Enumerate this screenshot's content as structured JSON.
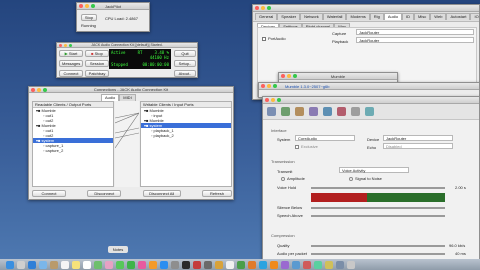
{
  "small_window": {
    "title": "JackPilot",
    "stop": "Stop",
    "running": "Running",
    "cpu_load": "CPU Load: 2.4867"
  },
  "control": {
    "title": "JACK Audio Connection Kit [(default)] Started.",
    "buttons": [
      "Start",
      "Stop",
      "Messages",
      "Session",
      "Connect",
      "Patchbay"
    ],
    "status": {
      "active": "Active",
      "rt": "RT",
      "load": "3.48 %",
      "rate": "44100 Hz",
      "stopped": "Stopped",
      "time": "00:00:00:00"
    },
    "side_buttons": [
      "Quit",
      "Setup..",
      "About.."
    ]
  },
  "connections": {
    "title": "Connections - JACK Audio Connection Kit",
    "tabs": [
      "Audio",
      "MIDI"
    ],
    "readable_header": "Readable Clients / Output Ports",
    "writable_header": "Writable Clients / Input Ports",
    "readable": [
      {
        "label": "Mumble",
        "level": 0
      },
      {
        "label": "out1",
        "level": 1
      },
      {
        "label": "out2",
        "level": 1
      },
      {
        "label": "Mumble",
        "level": 0
      },
      {
        "label": "out1",
        "level": 1
      },
      {
        "label": "out2",
        "level": 1
      },
      {
        "label": "system",
        "level": 0,
        "selected": true
      },
      {
        "label": "capture_1",
        "level": 1
      },
      {
        "label": "capture_2",
        "level": 1
      }
    ],
    "writable": [
      {
        "label": "Mumble",
        "level": 0
      },
      {
        "label": "input",
        "level": 1
      },
      {
        "label": "Mumble",
        "level": 0
      },
      {
        "label": "system",
        "level": 0,
        "selected": true
      },
      {
        "label": "playback_1",
        "level": 1
      },
      {
        "label": "playback_2",
        "level": 1
      }
    ],
    "buttons": {
      "connect": "Connect",
      "disconnect": "Disconnect",
      "disconnect_all": "Disconnect All",
      "refresh": "Refresh"
    }
  },
  "prefs": {
    "tabs": [
      "General",
      "Speaker",
      "Network",
      "Waterfall",
      "Modems",
      "Rig",
      "Audio",
      "ID",
      "Misc",
      "Web",
      "Autostart",
      "IO"
    ],
    "sub_tabs": [
      "Devices",
      "Settings",
      "Right channel",
      "Wav"
    ],
    "port_audio": "PortAudio",
    "capture_label": "Capture",
    "capture_value": "JackRouter",
    "playback_label": "Playback",
    "playback_value": "JackRouter",
    "rate_value": "48000"
  },
  "mumble_mini": {
    "title": "Mumble"
  },
  "mumble_main": {
    "title": "Mumble 1.3.0~2507~g6b"
  },
  "mumble_settings": {
    "title": "Mumble Configuration",
    "interface_group": "Interface",
    "system_label": "System",
    "system_value": "CoreAudio",
    "device_label": "Device",
    "device_value": "JackRouter",
    "exclusive_label": "Exclusive",
    "echo_label": "Echo",
    "echo_value": "Disabled",
    "transmission_group": "Transmission",
    "transmit_label": "Transmit",
    "transmit_value": "Voice Activity",
    "amplitude_label": "Amplitude",
    "signal_noise_label": "Signal to Noise",
    "voice_hold_label": "Voice Hold",
    "voice_hold_value": "2.00 s",
    "silence_below_label": "Silence Below",
    "speech_above_label": "Speech Above",
    "compression_group": "Compression",
    "quality_label": "Quality",
    "quality_value": "96.0 kb/s",
    "audio_per_packet_label": "Audio per packet",
    "audio_per_packet_value": "40 ms"
  },
  "notes_tooltip": "Notes"
}
